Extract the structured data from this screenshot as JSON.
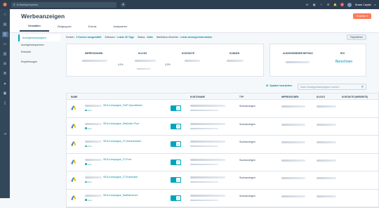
{
  "topbar": {
    "search_placeholder": "In HubSpot suchen",
    "user_name": "Brawe Capital",
    "notification_count": "1"
  },
  "header": {
    "title": "Werbeanzeigen",
    "create_label": "Erstellen",
    "tabs": [
      {
        "label": "Verwalten",
        "active": true
      },
      {
        "label": "Zielgruppen",
        "active": false
      },
      {
        "label": "Events",
        "active": false
      },
      {
        "label": "Analysieren",
        "active": false
      }
    ]
  },
  "sidebar": {
    "items": [
      {
        "label": "Anzeigenkampagnen",
        "active": true
      },
      {
        "label": "Anzeigensequenzen",
        "active": false
      },
      {
        "label": "Entwürfe",
        "active": false
      },
      {
        "label": "Empfehlungen",
        "active": false
      }
    ]
  },
  "filters": {
    "konten_label": "Konten:",
    "konten_value": "2 Konten ausgewählt",
    "zeitraum_label": "Zeitraum:",
    "zeitraum_value": "Letzte 30 Tage",
    "status_label": "Status:",
    "status_value": "Aktiv",
    "attribution_label": "Attribution-Berichte:",
    "attribution_value": "Letzte Anzeigeninteraktion",
    "export_label": "Exportieren"
  },
  "metrics": {
    "impressionen": "IMPRESSIONEN",
    "klicks": "KLICKS",
    "kontakte": "KONTAKTE",
    "kunden": "KUNDEN",
    "pct1": "4,1%",
    "pct2": "0,2%",
    "ausgegeben": "AUSGEGEBENER BETRAG",
    "roi": "ROI",
    "roi_link": "Berechnen"
  },
  "table": {
    "spalten_label": "Spalten bearbeiten",
    "search_placeholder": "Nach Anzeigenkampagnen suchen",
    "columns": [
      "NAME",
      "KONTONAME",
      "TYP",
      "IMPRESSIONEN",
      "KLICKS",
      "KONTAKTE (WEBSEITE)"
    ],
    "rows": [
      {
        "name": "SEA-Kampagne_GAP-Spezialisten",
        "status": "Aktiv",
        "type": "Suchanzeigen"
      },
      {
        "name": "SEA-Kampagne_Statiniker-Pool",
        "status": "Aktiv",
        "type": "Suchanzeigen"
      },
      {
        "name": "SEA-Kampagne_ZT-Administrator",
        "status": "Aktiv",
        "type": "Suchanzeigen"
      },
      {
        "name": "SEA-Kampagne_ZT-Pool",
        "status": "Aktiv",
        "type": "Suchanzeigen"
      },
      {
        "name": "SEA-Kampagne_ZT-Entwickler",
        "status": "Aktiv",
        "type": "Suchanzeigen"
      },
      {
        "name": "SEA-Kampagne_Statiklerinnen",
        "status": "Aktiv",
        "type": "Suchanzeigen"
      }
    ]
  }
}
